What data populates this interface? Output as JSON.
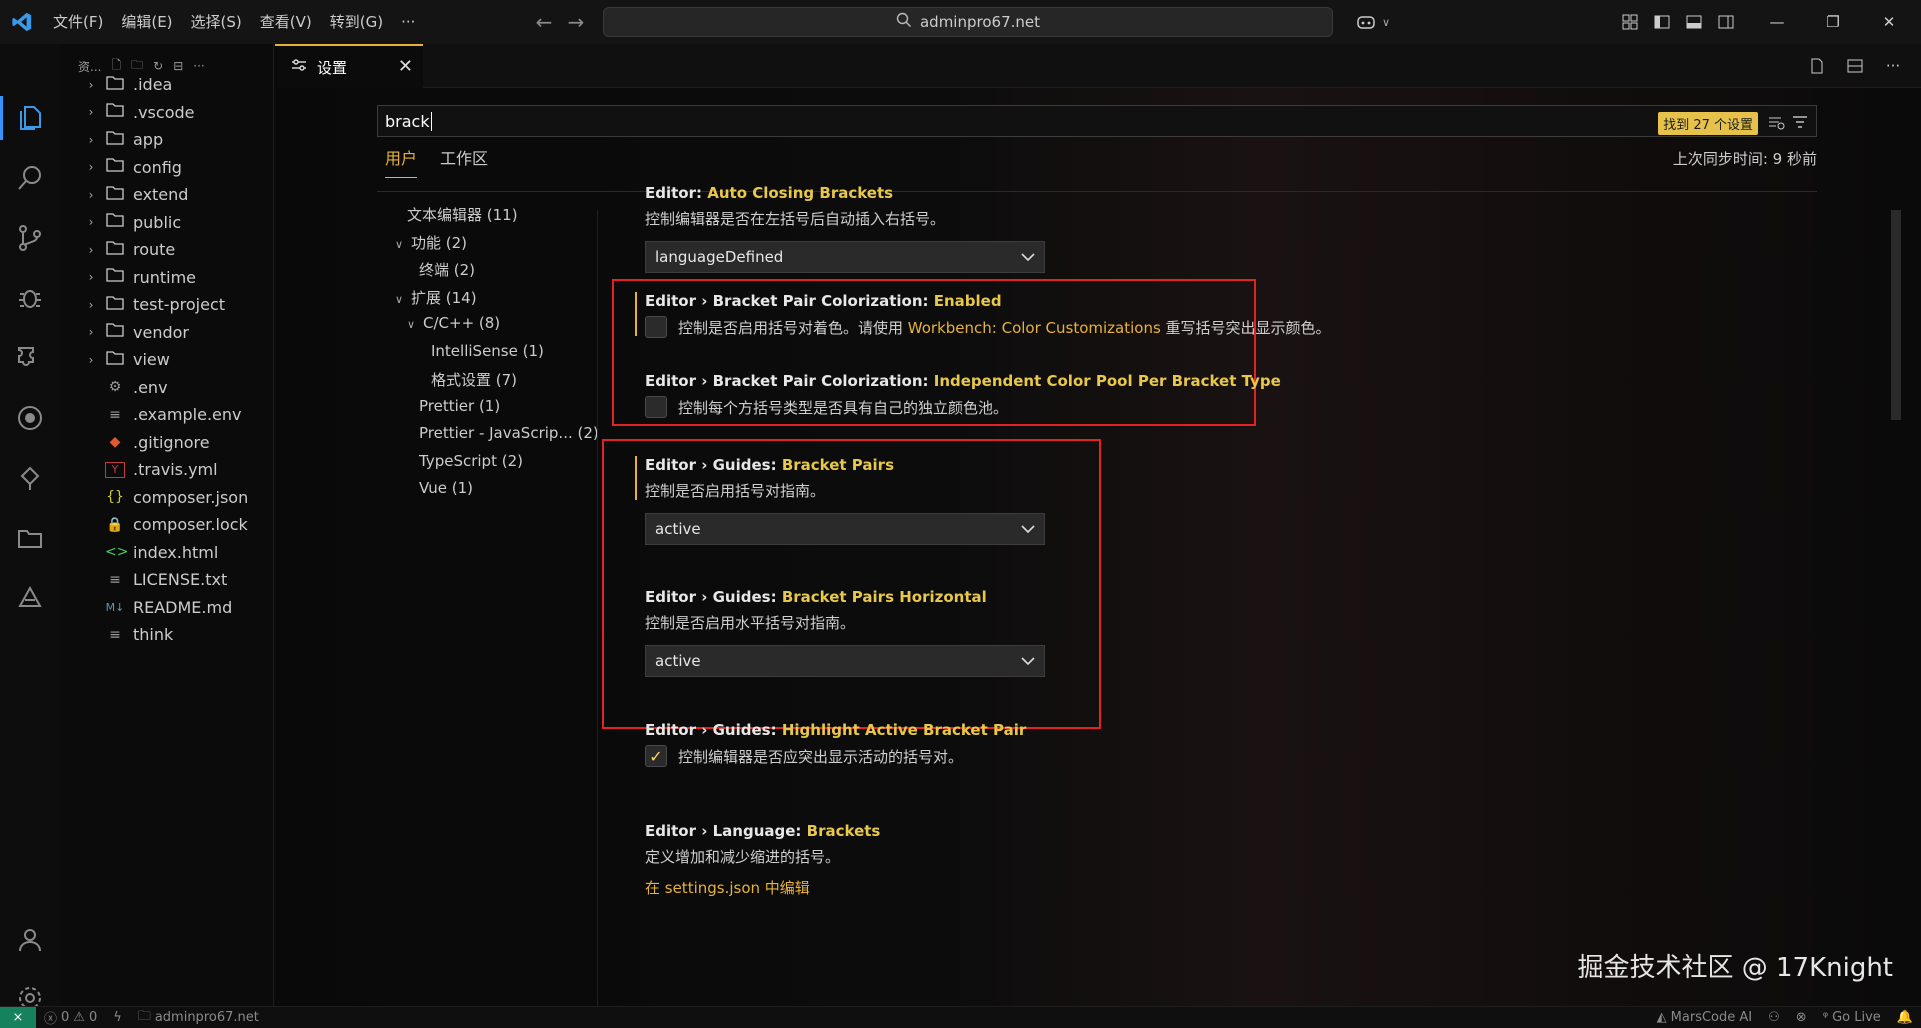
{
  "titlebar": {
    "menus": [
      "文件(F)",
      "编辑(E)",
      "选择(S)",
      "查看(V)",
      "转到(G)"
    ],
    "more": "···",
    "search_text": "adminpro67.net"
  },
  "explorer": {
    "header": "资...",
    "folders": [
      ".idea",
      ".vscode",
      "app",
      "config",
      "extend",
      "public",
      "route",
      "runtime",
      "test-project",
      "vendor",
      "view"
    ],
    "files": [
      ".env",
      ".example.env",
      ".gitignore",
      ".travis.yml",
      "composer.json",
      "composer.lock",
      "index.html",
      "LICENSE.txt",
      "README.md",
      "think"
    ],
    "file_icons": [
      "gear",
      "list",
      "git",
      "yaml",
      "braces",
      "lock",
      "code",
      "list",
      "markdown",
      "list"
    ],
    "icon_text": {
      "braces": "{}",
      "code": "<>",
      "markdown": "M↓",
      "yaml": "Y"
    }
  },
  "tab": {
    "label": "设置"
  },
  "settings": {
    "search_value": "brack",
    "found": "找到 27 个设置",
    "scope_user": "用户",
    "scope_workspace": "工作区",
    "sync": "上次同步时间: 9 秒前",
    "toc": [
      {
        "label": "文本编辑器 (11)",
        "chev": ""
      },
      {
        "label": "功能 (2)",
        "chev": "∨"
      },
      {
        "label": "终端 (2)",
        "chev": ""
      },
      {
        "label": "扩展 (14)",
        "chev": "∨"
      },
      {
        "label": "C/C++ (8)",
        "chev": "∨"
      },
      {
        "label": "IntelliSense (1)",
        "chev": ""
      },
      {
        "label": "格式设置 (7)",
        "chev": ""
      },
      {
        "label": "Prettier (1)",
        "chev": ""
      },
      {
        "label": "Prettier - JavaScrip... (2)",
        "chev": ""
      },
      {
        "label": "TypeScript (2)",
        "chev": ""
      },
      {
        "label": "Vue (1)",
        "chev": ""
      }
    ],
    "items": {
      "auto_closing": {
        "prefix": "Editor: ",
        "name": "Auto Closing Brackets",
        "desc": "控制编辑器是否在左括号后自动插入右括号。",
        "value": "languageDefined"
      },
      "bpc_enabled": {
        "prefix": "Editor › Bracket Pair Colorization: ",
        "name": "Enabled",
        "desc_a": "控制是否启用括号对着色。请使用 ",
        "desc_link": "Workbench: Color Customizations",
        "desc_b": " 重写括号突出显示颜色。",
        "checked": false
      },
      "bpc_independent": {
        "prefix": "Editor › Bracket Pair Colorization: ",
        "name": "Independent Color Pool Per Bracket Type",
        "desc": "控制每个方括号类型是否具有自己的独立颜色池。",
        "checked": false
      },
      "guides_pairs": {
        "prefix": "Editor › Guides: ",
        "name": "Bracket Pairs",
        "desc": "控制是否启用括号对指南。",
        "value": "active"
      },
      "guides_horizontal": {
        "prefix": "Editor › Guides: ",
        "name": "Bracket Pairs Horizontal",
        "desc": "控制是否启用水平括号对指南。",
        "value": "active"
      },
      "guides_highlight": {
        "prefix": "Editor › Guides: ",
        "name": "Highlight Active Bracket Pair",
        "desc": "控制编辑器是否应突出显示活动的括号对。",
        "checked": true
      },
      "language_brackets": {
        "prefix": "Editor › Language: ",
        "name": "Brackets",
        "desc": "定义增加和减少缩进的括号。",
        "link": "在 settings.json 中编辑"
      }
    }
  },
  "watermark": "掘金技术社区 @ 17Knight",
  "statusbar": {
    "errors": "0",
    "warnings": "0",
    "folder": "adminpro67.net",
    "marscode": "MarsCode AI",
    "golive": "Go Live"
  },
  "colors": {
    "accent": "#e8b23a",
    "highlight": "#e8c84a",
    "annotation_red": "#e02424"
  }
}
